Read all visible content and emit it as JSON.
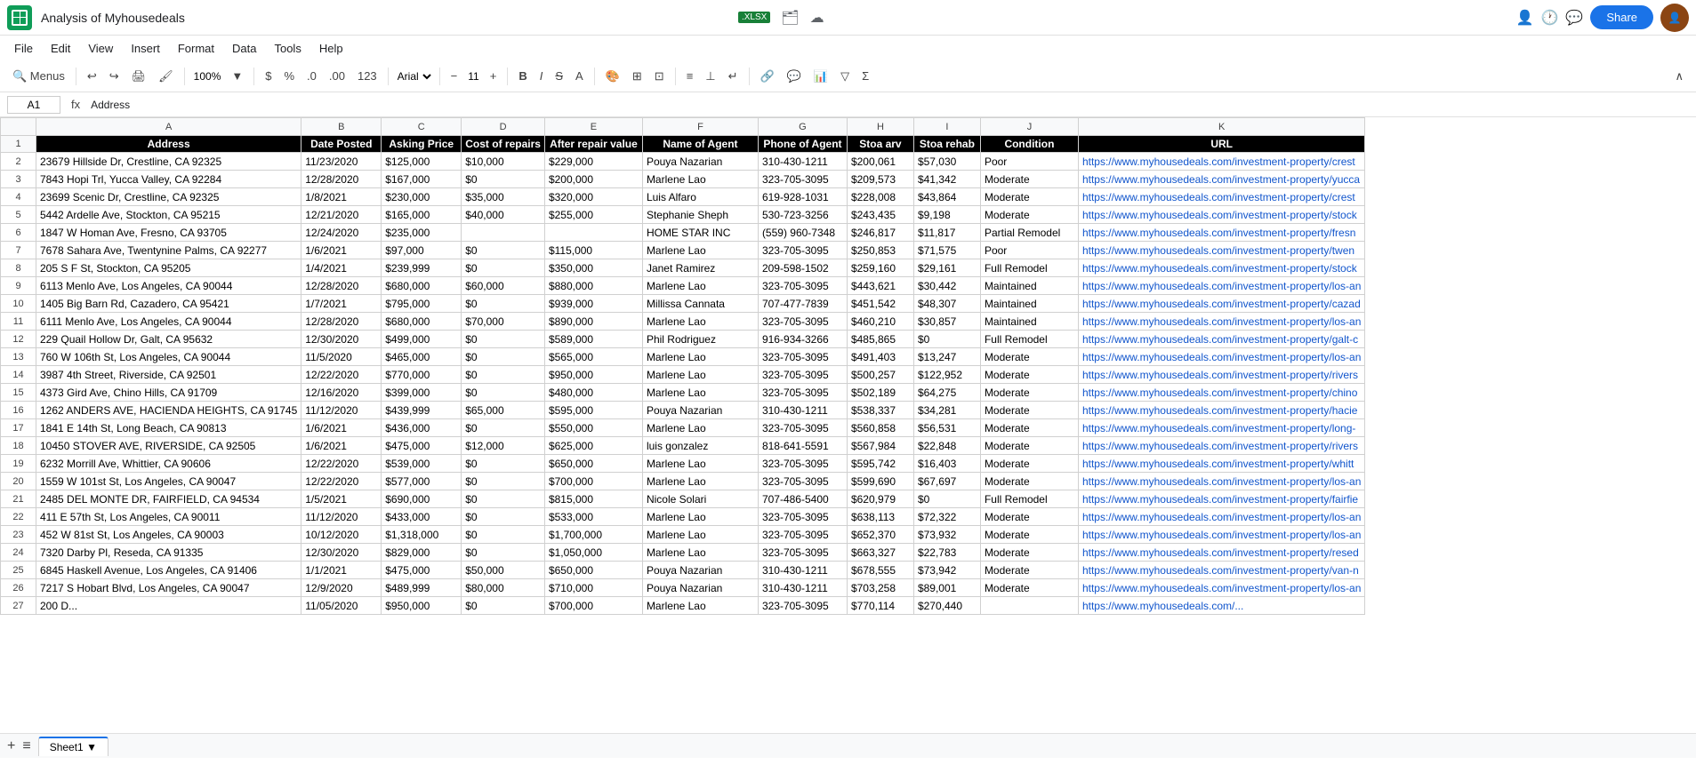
{
  "app": {
    "title": "Analysis of Myhousedeals",
    "badge": ".XLSX",
    "share_label": "Share"
  },
  "menu": {
    "items": [
      "File",
      "Edit",
      "View",
      "Insert",
      "Format",
      "Data",
      "Tools",
      "Help"
    ]
  },
  "toolbar": {
    "zoom": "100%",
    "font": "Arial",
    "font_size": "11"
  },
  "formula_bar": {
    "cell_ref": "A1",
    "formula_label": "fx",
    "formula_content": "Address"
  },
  "sheet": {
    "columns": {
      "letters": [
        "A",
        "B",
        "C",
        "D",
        "E",
        "F",
        "G",
        "H",
        "I",
        "J",
        "K"
      ]
    },
    "headers": [
      "Address",
      "Date Posted",
      "Asking Price",
      "Cost of repairs",
      "After repair value",
      "Name of Agent",
      "Phone of Agent",
      "Stoa arv",
      "Stoa rehab",
      "Condition",
      "URL"
    ],
    "rows": [
      [
        "23679 Hillside Dr, Crestline, CA 92325",
        "11/23/2020",
        "$125,000",
        "$10,000",
        "$229,000",
        "Pouya Nazarian",
        "310-430-1211",
        "$200,061",
        "$57,030",
        "Poor",
        "https://www.myhousedeals.com/investment-property/crest"
      ],
      [
        "7843 Hopi Trl, Yucca Valley, CA 92284",
        "12/28/2020",
        "$167,000",
        "$0",
        "$200,000",
        "Marlene Lao",
        "323-705-3095",
        "$209,573",
        "$41,342",
        "Moderate",
        "https://www.myhousedeals.com/investment-property/yucca"
      ],
      [
        "23699 Scenic Dr, Crestline, CA 92325",
        "1/8/2021",
        "$230,000",
        "$35,000",
        "$320,000",
        "Luis Alfaro",
        "619-928-1031",
        "$228,008",
        "$43,864",
        "Moderate",
        "https://www.myhousedeals.com/investment-property/crest"
      ],
      [
        "5442 Ardelle Ave, Stockton, CA 95215",
        "12/21/2020",
        "$165,000",
        "$40,000",
        "$255,000",
        "Stephanie Sheph",
        "530-723-3256",
        "$243,435",
        "$9,198",
        "Moderate",
        "https://www.myhousedeals.com/investment-property/stock"
      ],
      [
        "1847 W Homan Ave, Fresno, CA 93705",
        "12/24/2020",
        "$235,000",
        "",
        "",
        "HOME STAR INC",
        "(559) 960-7348",
        "$246,817",
        "$11,817",
        "Partial Remodel",
        "https://www.myhousedeals.com/investment-property/fresn"
      ],
      [
        "7678 Sahara Ave, Twentynine Palms, CA 92277",
        "1/6/2021",
        "$97,000",
        "$0",
        "$115,000",
        "Marlene Lao",
        "323-705-3095",
        "$250,853",
        "$71,575",
        "Poor",
        "https://www.myhousedeals.com/investment-property/twen"
      ],
      [
        "205 S F St, Stockton, CA 95205",
        "1/4/2021",
        "$239,999",
        "$0",
        "$350,000",
        "Janet Ramirez",
        "209-598-1502",
        "$259,160",
        "$29,161",
        "Full Remodel",
        "https://www.myhousedeals.com/investment-property/stock"
      ],
      [
        "6113 Menlo Ave, Los Angeles, CA 90044",
        "12/28/2020",
        "$680,000",
        "$60,000",
        "$880,000",
        "Marlene Lao",
        "323-705-3095",
        "$443,621",
        "$30,442",
        "Maintained",
        "https://www.myhousedeals.com/investment-property/los-an"
      ],
      [
        "1405 Big Barn Rd, Cazadero, CA 95421",
        "1/7/2021",
        "$795,000",
        "$0",
        "$939,000",
        "Millissa Cannata",
        "707-477-7839",
        "$451,542",
        "$48,307",
        "Maintained",
        "https://www.myhousedeals.com/investment-property/cazad"
      ],
      [
        "6111 Menlo Ave, Los Angeles, CA 90044",
        "12/28/2020",
        "$680,000",
        "$70,000",
        "$890,000",
        "Marlene Lao",
        "323-705-3095",
        "$460,210",
        "$30,857",
        "Maintained",
        "https://www.myhousedeals.com/investment-property/los-an"
      ],
      [
        "229 Quail Hollow Dr, Galt, CA 95632",
        "12/30/2020",
        "$499,000",
        "$0",
        "$589,000",
        "Phil Rodriguez",
        "916-934-3266",
        "$485,865",
        "$0",
        "Full Remodel",
        "https://www.myhousedeals.com/investment-property/galt-c"
      ],
      [
        "760 W 106th St, Los Angeles, CA 90044",
        "11/5/2020",
        "$465,000",
        "$0",
        "$565,000",
        "Marlene Lao",
        "323-705-3095",
        "$491,403",
        "$13,247",
        "Moderate",
        "https://www.myhousedeals.com/investment-property/los-an"
      ],
      [
        "3987 4th Street, Riverside, CA 92501",
        "12/22/2020",
        "$770,000",
        "$0",
        "$950,000",
        "Marlene Lao",
        "323-705-3095",
        "$500,257",
        "$122,952",
        "Moderate",
        "https://www.myhousedeals.com/investment-property/rivers"
      ],
      [
        "4373 Gird Ave, Chino Hills, CA 91709",
        "12/16/2020",
        "$399,000",
        "$0",
        "$480,000",
        "Marlene Lao",
        "323-705-3095",
        "$502,189",
        "$64,275",
        "Moderate",
        "https://www.myhousedeals.com/investment-property/chino"
      ],
      [
        "1262 ANDERS AVE, HACIENDA HEIGHTS, CA 91745",
        "11/12/2020",
        "$439,999",
        "$65,000",
        "$595,000",
        "Pouya Nazarian",
        "310-430-1211",
        "$538,337",
        "$34,281",
        "Moderate",
        "https://www.myhousedeals.com/investment-property/hacie"
      ],
      [
        "1841 E 14th St, Long Beach, CA 90813",
        "1/6/2021",
        "$436,000",
        "$0",
        "$550,000",
        "Marlene Lao",
        "323-705-3095",
        "$560,858",
        "$56,531",
        "Moderate",
        "https://www.myhousedeals.com/investment-property/long-"
      ],
      [
        "10450 STOVER AVE, RIVERSIDE, CA 92505",
        "1/6/2021",
        "$475,000",
        "$12,000",
        "$625,000",
        "luis gonzalez",
        "818-641-5591",
        "$567,984",
        "$22,848",
        "Moderate",
        "https://www.myhousedeals.com/investment-property/rivers"
      ],
      [
        "6232 Morrill Ave, Whittier, CA 90606",
        "12/22/2020",
        "$539,000",
        "$0",
        "$650,000",
        "Marlene Lao",
        "323-705-3095",
        "$595,742",
        "$16,403",
        "Moderate",
        "https://www.myhousedeals.com/investment-property/whitt"
      ],
      [
        "1559 W 101st St, Los Angeles, CA 90047",
        "12/22/2020",
        "$577,000",
        "$0",
        "$700,000",
        "Marlene Lao",
        "323-705-3095",
        "$599,690",
        "$67,697",
        "Moderate",
        "https://www.myhousedeals.com/investment-property/los-an"
      ],
      [
        "2485 DEL MONTE DR, FAIRFIELD, CA 94534",
        "1/5/2021",
        "$690,000",
        "$0",
        "$815,000",
        "Nicole Solari",
        "707-486-5400",
        "$620,979",
        "$0",
        "Full Remodel",
        "https://www.myhousedeals.com/investment-property/fairfie"
      ],
      [
        "411 E 57th St, Los Angeles, CA 90011",
        "11/12/2020",
        "$433,000",
        "$0",
        "$533,000",
        "Marlene Lao",
        "323-705-3095",
        "$638,113",
        "$72,322",
        "Moderate",
        "https://www.myhousedeals.com/investment-property/los-an"
      ],
      [
        "452 W 81st St, Los Angeles, CA 90003",
        "10/12/2020",
        "$1,318,000",
        "$0",
        "$1,700,000",
        "Marlene Lao",
        "323-705-3095",
        "$652,370",
        "$73,932",
        "Moderate",
        "https://www.myhousedeals.com/investment-property/los-an"
      ],
      [
        "7320 Darby Pl, Reseda, CA 91335",
        "12/30/2020",
        "$829,000",
        "$0",
        "$1,050,000",
        "Marlene Lao",
        "323-705-3095",
        "$663,327",
        "$22,783",
        "Moderate",
        "https://www.myhousedeals.com/investment-property/resed"
      ],
      [
        "6845 Haskell Avenue, Los Angeles, CA 91406",
        "1/1/2021",
        "$475,000",
        "$50,000",
        "$650,000",
        "Pouya Nazarian",
        "310-430-1211",
        "$678,555",
        "$73,942",
        "Moderate",
        "https://www.myhousedeals.com/investment-property/van-n"
      ],
      [
        "7217 S Hobart Blvd, Los Angeles, CA 90047",
        "12/9/2020",
        "$489,999",
        "$80,000",
        "$710,000",
        "Pouya Nazarian",
        "310-430-1211",
        "$703,258",
        "$89,001",
        "Moderate",
        "https://www.myhousedeals.com/investment-property/los-an"
      ],
      [
        "200 D...",
        "11/05/2020",
        "$950,000",
        "$0",
        "$700,000",
        "Marlene Lao",
        "323-705-3095",
        "$770,114",
        "$270,440",
        "",
        "https://www.myhousedeals.com/..."
      ]
    ]
  },
  "bottom": {
    "sheet_name": "Sheet1"
  }
}
